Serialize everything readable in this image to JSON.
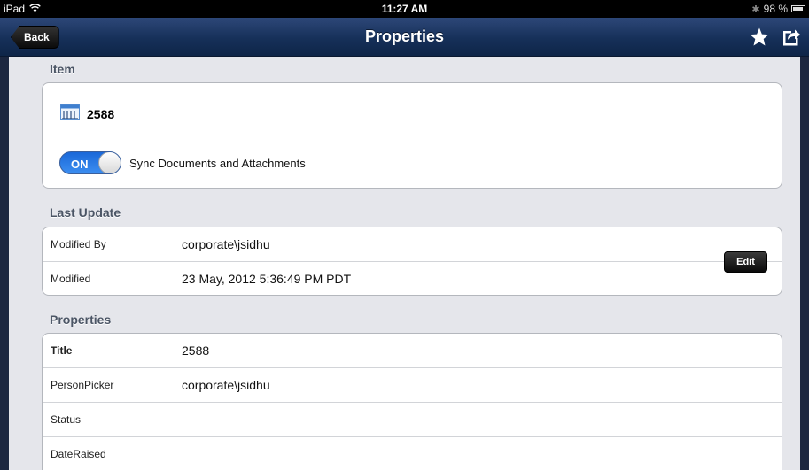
{
  "status_bar": {
    "carrier": "iPad",
    "time": "11:27 AM",
    "battery": "98 %"
  },
  "nav": {
    "back_label": "Back",
    "title": "Properties"
  },
  "item_section": {
    "title": "Item",
    "item_name": "2588",
    "sync_toggle_state": "ON",
    "sync_label": "Sync Documents and Attachments"
  },
  "last_update": {
    "title": "Last Update",
    "rows": [
      {
        "key": "Modified By",
        "value": "corporate\\jsidhu"
      },
      {
        "key": "Modified",
        "value": "23 May, 2012 5:36:49 PM PDT"
      }
    ]
  },
  "properties": {
    "title": "Properties",
    "edit_label": "Edit",
    "rows": [
      {
        "key": "Title",
        "value": "2588"
      },
      {
        "key": "PersonPicker",
        "value": " corporate\\jsidhu"
      },
      {
        "key": "Status",
        "value": ""
      },
      {
        "key": "DateRaised",
        "value": ""
      }
    ]
  },
  "colors": {
    "nav_bar": "#163059",
    "toggle_on": "#2a7be6",
    "background": "#e5e6eb"
  }
}
